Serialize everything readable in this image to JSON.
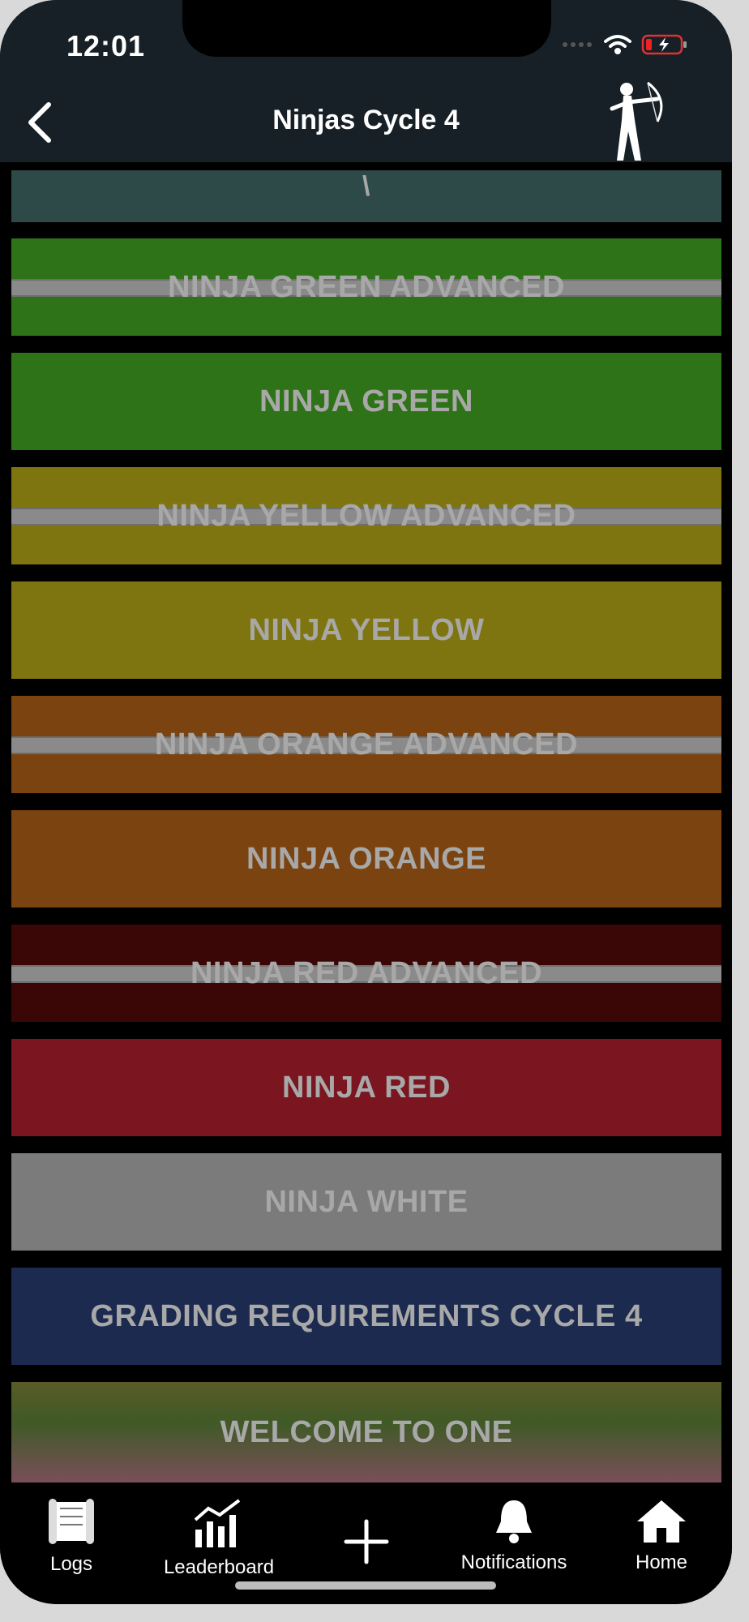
{
  "status": {
    "time": "12:01"
  },
  "header": {
    "title": "Ninjas Cycle 4"
  },
  "cards": [
    {
      "label": "\\",
      "bg": "#2e4a48",
      "stripe": false
    },
    {
      "label": "NINJA GREEN ADVANCED",
      "bg": "#2f7318",
      "stripe": true
    },
    {
      "label": "NINJA GREEN",
      "bg": "#2f7318",
      "stripe": false
    },
    {
      "label": "NINJA YELLOW ADVANCED",
      "bg": "#7f7510",
      "stripe": true
    },
    {
      "label": "NINJA YELLOW",
      "bg": "#7f7510",
      "stripe": false
    },
    {
      "label": "NINJA ORANGE ADVANCED",
      "bg": "#7a430f",
      "stripe": true
    },
    {
      "label": "NINJA ORANGE",
      "bg": "#7a430f",
      "stripe": false
    },
    {
      "label": "NINJA RED ADVANCED",
      "bg": "#3a0606",
      "stripe": true
    },
    {
      "label": "NINJA RED",
      "bg": "#7b1520",
      "stripe": false
    },
    {
      "label": "NINJA WHITE",
      "bg": "#7b7b7b",
      "stripe": false
    },
    {
      "label": "GRADING REQUIREMENTS CYCLE 4",
      "bg": "#1b2a4e",
      "stripe": false
    },
    {
      "label": "WELCOME TO ONE",
      "bg": "#5a5b28",
      "stripe": false
    }
  ],
  "tabs": [
    {
      "label": "Logs",
      "icon": "scroll-icon"
    },
    {
      "label": "Leaderboard",
      "icon": "bar-chart-icon"
    },
    {
      "label": "",
      "icon": "plus-icon"
    },
    {
      "label": "Notifications",
      "icon": "bell-icon"
    },
    {
      "label": "Home",
      "icon": "home-icon"
    }
  ]
}
